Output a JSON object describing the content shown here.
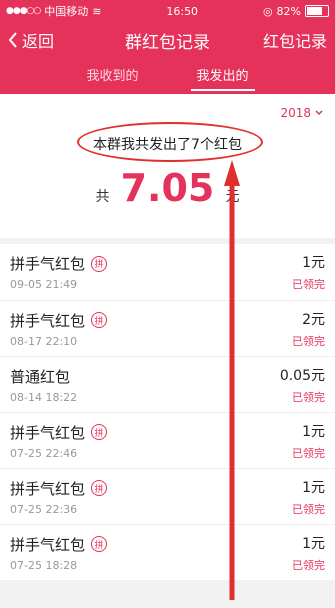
{
  "statusbar": {
    "carrier": "中国移动",
    "time": "16:50",
    "battery": "82%",
    "battery_level": 0.82
  },
  "navbar": {
    "back_label": "返回",
    "title": "群红包记录",
    "right_label": "红包记录"
  },
  "tabs": [
    {
      "label": "我收到的"
    },
    {
      "label": "我发出的"
    }
  ],
  "summary": {
    "year": "2018",
    "sent_text": "本群我共发出了7个红包",
    "prefix": "共",
    "amount": "7.05",
    "unit": "元"
  },
  "records": [
    {
      "name": "拼手气红包",
      "badge": "拼",
      "date": "09-05 21:49",
      "amount": "1元",
      "status": "已领完"
    },
    {
      "name": "拼手气红包",
      "badge": "拼",
      "date": "08-17 22:10",
      "amount": "2元",
      "status": "已领完"
    },
    {
      "name": "普通红包",
      "badge": "",
      "date": "08-14 18:22",
      "amount": "0.05元",
      "status": "已领完"
    },
    {
      "name": "拼手气红包",
      "badge": "拼",
      "date": "07-25 22:46",
      "amount": "1元",
      "status": "已领完"
    },
    {
      "name": "拼手气红包",
      "badge": "拼",
      "date": "07-25 22:36",
      "amount": "1元",
      "status": "已领完"
    },
    {
      "name": "拼手气红包",
      "badge": "拼",
      "date": "07-25 18:28",
      "amount": "1元",
      "status": "已领完"
    }
  ],
  "colors": {
    "brand": "#e5325a",
    "annotation": "#e0302d"
  }
}
